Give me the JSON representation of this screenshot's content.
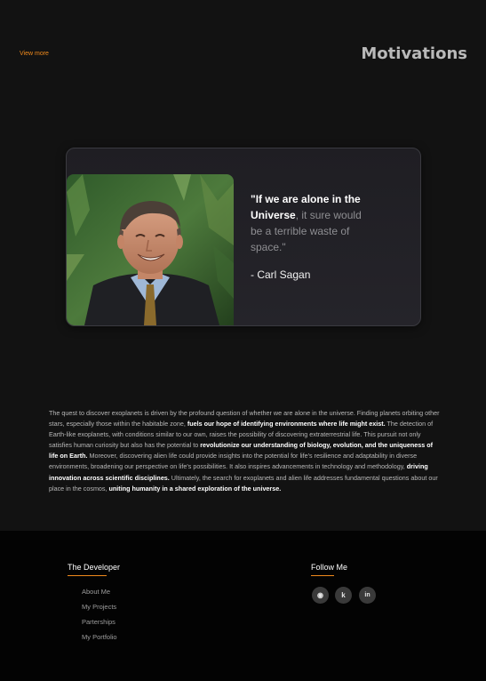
{
  "header": {
    "view_more": "View more",
    "title": "Motivations"
  },
  "quote": {
    "bold_part": "\"If we are alone in the Universe",
    "rest_part": ", it sure would be a terrible waste of space.\"",
    "author": "- Carl Sagan"
  },
  "description": {
    "p1": "The quest to discover exoplanets is driven by the profound question of whether we are alone in the universe. Finding planets orbiting other stars, especially those within the habitable zone, ",
    "b1": "fuels our hope of identifying environments where life might exist.",
    "p2": " The detection of Earth-like exoplanets, with conditions similar to our own, raises the possibility of discovering extraterrestrial life. This pursuit not only satisfies human curiosity but also has the potential to ",
    "b2": "revolutionize our understanding of biology, evolution, and the uniqueness of life on Earth.",
    "p3": " Moreover, discovering alien life could provide insights into the potential for life's resilience and adaptability in diverse environments, broadening our perspective on life's possibilities. It also inspires advancements in technology and methodology, ",
    "b3": "driving innovation across scientific disciplines.",
    "p4": " Ultimately, the search for exoplanets and alien life addresses fundamental questions about our place in the cosmos, ",
    "b4": "uniting humanity in a shared exploration of the universe."
  },
  "footer": {
    "developer_title": "The Developer",
    "links": [
      "About Me",
      "My Projects",
      "Parterships",
      "My Portfolio"
    ],
    "follow_title": "Follow Me",
    "social": [
      {
        "icon": "github-icon",
        "glyph": "◉"
      },
      {
        "icon": "kaggle-icon",
        "glyph": "k"
      },
      {
        "icon": "linkedin-icon",
        "glyph": "in"
      }
    ]
  },
  "colors": {
    "accent": "#f08a1c",
    "background": "#121212",
    "footer_background": "#030303",
    "card_background": "#222127"
  }
}
